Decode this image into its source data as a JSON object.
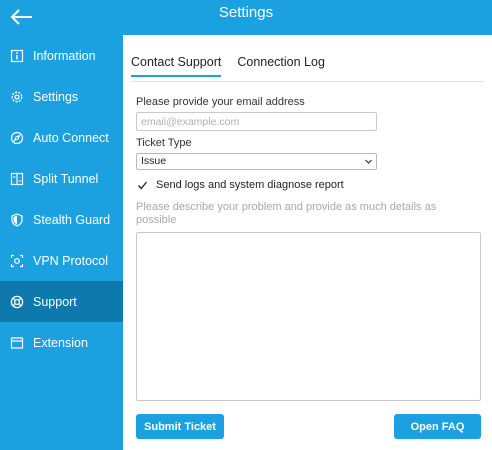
{
  "header": {
    "title": "Settings",
    "back_icon": "arrow-left-icon"
  },
  "sidebar": {
    "items": [
      {
        "label": "Information",
        "icon": "info-icon",
        "active": false
      },
      {
        "label": "Settings",
        "icon": "gear-icon",
        "active": false
      },
      {
        "label": "Auto Connect",
        "icon": "auto-connect-icon",
        "active": false
      },
      {
        "label": "Split Tunnel",
        "icon": "split-tunnel-icon",
        "active": false
      },
      {
        "label": "Stealth Guard",
        "icon": "shield-icon",
        "active": false
      },
      {
        "label": "VPN Protocol",
        "icon": "protocol-icon",
        "active": false
      },
      {
        "label": "Support",
        "icon": "lifebuoy-icon",
        "active": true
      },
      {
        "label": "Extension",
        "icon": "browser-window-icon",
        "active": false
      }
    ]
  },
  "tabs": [
    {
      "label": "Contact Support",
      "active": true
    },
    {
      "label": "Connection Log",
      "active": false
    }
  ],
  "form": {
    "email_label": "Please provide your email address",
    "email_placeholder": "email@example.com",
    "email_value": "",
    "ticket_type_label": "Ticket Type",
    "ticket_type_value": "Issue",
    "send_logs_label": "Send logs and system diagnose report",
    "send_logs_checked": true,
    "description_label": "Please describe your problem and provide as much details as possible",
    "description_value": ""
  },
  "buttons": {
    "submit": "Submit Ticket",
    "faq": "Open FAQ"
  },
  "colors": {
    "accent": "#1ba1df",
    "sidebar_active": "#0d79ad",
    "background": "#ffffff"
  }
}
